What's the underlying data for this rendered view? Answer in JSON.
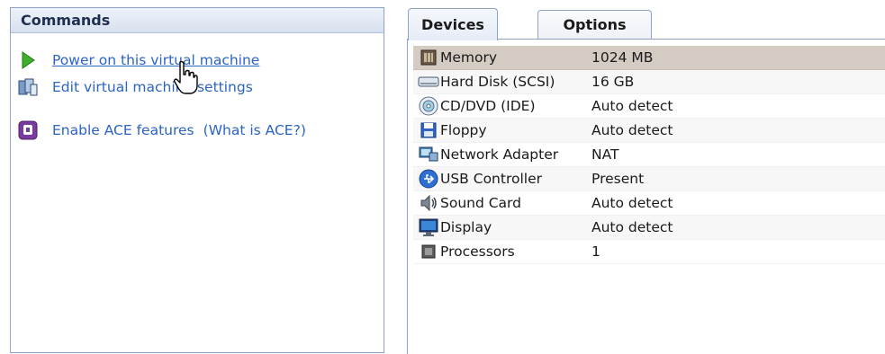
{
  "commands": {
    "title": "Commands",
    "items": [
      {
        "label": "Power on this virtual machine",
        "icon": "play-icon"
      },
      {
        "label": "Edit virtual machine settings",
        "icon": "vm-settings-icon"
      },
      {
        "label": "Enable ACE features",
        "link": "(What is ACE?)",
        "icon": "ace-icon"
      }
    ]
  },
  "tabs": [
    {
      "label": "Devices",
      "active": true
    },
    {
      "label": "Options",
      "active": false
    }
  ],
  "devices": [
    {
      "name": "Memory",
      "value": "1024 MB",
      "icon": "memory-icon"
    },
    {
      "name": "Hard Disk (SCSI)",
      "value": "16 GB",
      "icon": "hard-disk-icon"
    },
    {
      "name": "CD/DVD (IDE)",
      "value": "Auto detect",
      "icon": "cd-dvd-icon"
    },
    {
      "name": "Floppy",
      "value": "Auto detect",
      "icon": "floppy-icon"
    },
    {
      "name": "Network Adapter",
      "value": "NAT",
      "icon": "network-adapter-icon"
    },
    {
      "name": "USB Controller",
      "value": "Present",
      "icon": "usb-icon"
    },
    {
      "name": "Sound Card",
      "value": "Auto detect",
      "icon": "sound-card-icon"
    },
    {
      "name": "Display",
      "value": "Auto detect",
      "icon": "display-icon"
    },
    {
      "name": "Processors",
      "value": "1",
      "icon": "processor-icon"
    }
  ],
  "colors": {
    "link": "#2b63c6",
    "selected_row": "#d4cbc3",
    "panel_border": "#8fa3c8"
  }
}
